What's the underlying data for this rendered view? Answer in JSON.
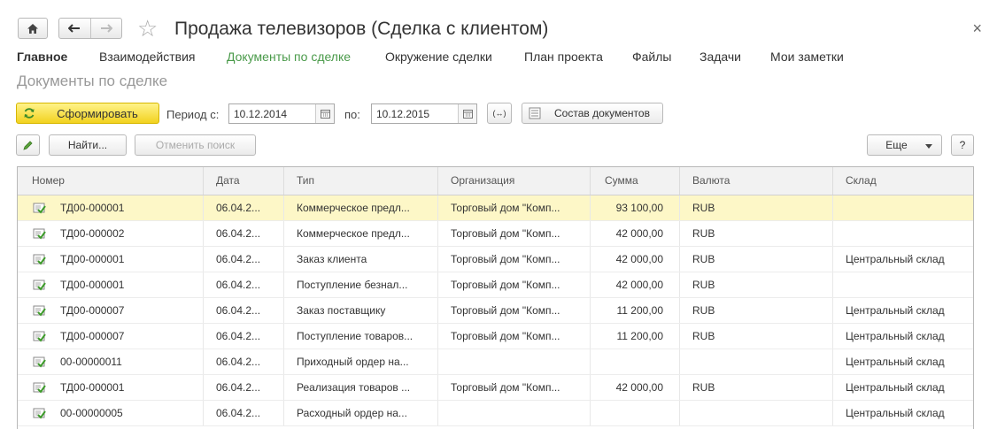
{
  "window": {
    "title": "Продажа телевизоров (Сделка с клиентом)",
    "close_glyph": "×"
  },
  "tabs": [
    {
      "label": "Главное"
    },
    {
      "label": "Взаимодействия"
    },
    {
      "label": "Документы по сделке"
    },
    {
      "label": "Окружение сделки"
    },
    {
      "label": "План проекта"
    },
    {
      "label": "Файлы"
    },
    {
      "label": "Задачи"
    },
    {
      "label": "Мои заметки"
    }
  ],
  "active_tab": "Документы по сделке",
  "section_title": "Документы по сделке",
  "toolbar": {
    "generate_label": "Сформировать",
    "period_from_label": "Период с:",
    "date_from": "10.12.2014",
    "period_to_label": "по:",
    "date_to": "10.12.2015",
    "period_btn": "(↔)",
    "composition_label": "Состав документов",
    "find_label": "Найти...",
    "cancel_search_label": "Отменить поиск",
    "more_label": "Еще",
    "help_label": "?"
  },
  "table": {
    "columns": [
      "Номер",
      "Дата",
      "Тип",
      "Организация",
      "Сумма",
      "Валюта",
      "Склад"
    ],
    "rows": [
      {
        "num": "ТД00-000001",
        "date": "06.04.2...",
        "type": "Коммерческое предл...",
        "org": "Торговый дом \"Комп...",
        "sum": "93 100,00",
        "cur": "RUB",
        "wh": ""
      },
      {
        "num": "ТД00-000002",
        "date": "06.04.2...",
        "type": "Коммерческое предл...",
        "org": "Торговый дом \"Комп...",
        "sum": "42 000,00",
        "cur": "RUB",
        "wh": ""
      },
      {
        "num": "ТД00-000001",
        "date": "06.04.2...",
        "type": "Заказ клиента",
        "org": "Торговый дом \"Комп...",
        "sum": "42 000,00",
        "cur": "RUB",
        "wh": "Центральный склад"
      },
      {
        "num": "ТД00-000001",
        "date": "06.04.2...",
        "type": "Поступление безнал...",
        "org": "Торговый дом \"Комп...",
        "sum": "42 000,00",
        "cur": "RUB",
        "wh": ""
      },
      {
        "num": "ТД00-000007",
        "date": "06.04.2...",
        "type": "Заказ поставщику",
        "org": "Торговый дом \"Комп...",
        "sum": "11 200,00",
        "cur": "RUB",
        "wh": "Центральный склад"
      },
      {
        "num": "ТД00-000007",
        "date": "06.04.2...",
        "type": "Поступление товаров...",
        "org": "Торговый дом \"Комп...",
        "sum": "11 200,00",
        "cur": "RUB",
        "wh": "Центральный склад"
      },
      {
        "num": "00-00000011",
        "date": "06.04.2...",
        "type": "Приходный ордер на...",
        "org": "",
        "sum": "",
        "cur": "",
        "wh": "Центральный склад"
      },
      {
        "num": "ТД00-000001",
        "date": "06.04.2...",
        "type": "Реализация товаров ...",
        "org": "Торговый дом \"Комп...",
        "sum": "42 000,00",
        "cur": "RUB",
        "wh": "Центральный склад"
      },
      {
        "num": "00-00000005",
        "date": "06.04.2...",
        "type": "Расходный ордер на...",
        "org": "",
        "sum": "",
        "cur": "",
        "wh": "Центральный склад"
      }
    ]
  },
  "colors": {
    "active_tab": "#4a9a4a",
    "generate_button": "#f2d21f",
    "selected_row": "#fdf7c7"
  },
  "icons": [
    "home-icon",
    "back-arrow-icon",
    "forward-arrow-icon",
    "star-icon",
    "close-icon",
    "refresh-icon",
    "calendar-icon",
    "settings-list-icon",
    "edit-pencil-icon",
    "dropdown-arrow-icon",
    "document-posted-icon"
  ]
}
